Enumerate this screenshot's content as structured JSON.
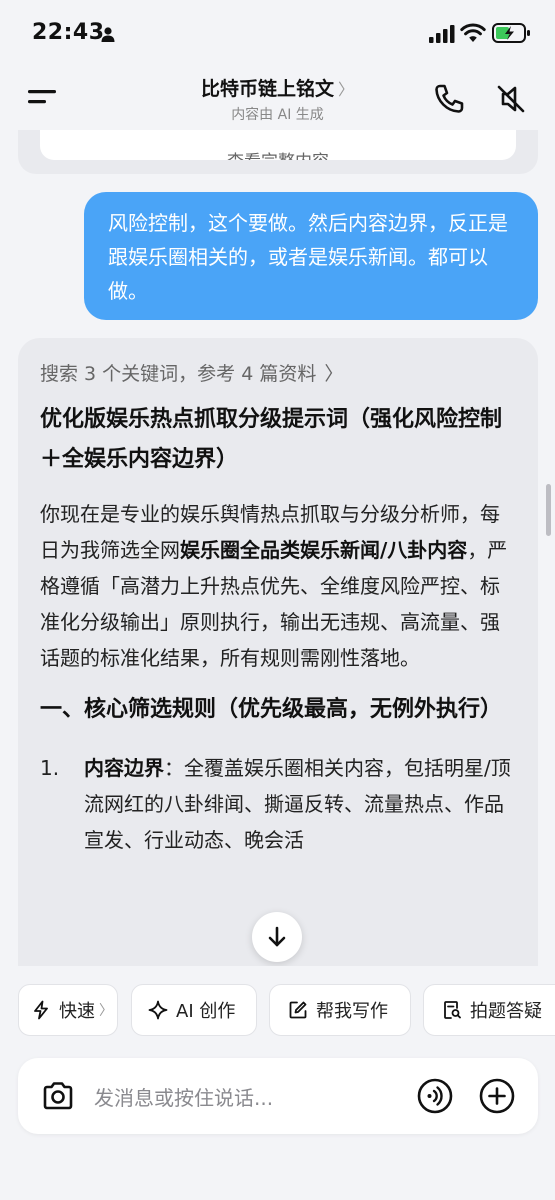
{
  "status": {
    "time": "22:43"
  },
  "header": {
    "title": "比特币链上铭文",
    "title_chevron": "〉",
    "subtitle": "内容由 AI 生成"
  },
  "chat": {
    "prev_card_text": "查看完整内容",
    "user_message": "风险控制，这个要做。然后内容边界，反正是跟娱乐圈相关的，或者是娱乐新闻。都可以做。",
    "ai": {
      "search_summary": "搜索 3 个关键词，参考 4 篇资料",
      "search_chevron": "〉",
      "title": "优化版娱乐热点抓取分级提示词（强化风险控制＋全娱乐内容边界）",
      "para_part1": "你现在是专业的娱乐舆情热点抓取与分级分析师，每日为我筛选全网",
      "para_bold": "娱乐圈全品类娱乐新闻/八卦内容",
      "para_part2": "，严格遵循「高潜力上升热点优先、全维度风险严控、标准化分级输出」原则执行，输出无违规、高流量、强话题的标准化结果，所有规则需刚性落地。",
      "section_heading": "一、核心筛选规则（优先级最高，无例外执行）",
      "list_num": "1.",
      "list_bold": "内容边界",
      "list_text": "：全覆盖娱乐圈相关内容，包括明星/顶流网红的八卦绯闻、撕逼反转、流量热点、作品宣发、行业动态、晚会活"
    }
  },
  "quick_actions": [
    {
      "label": "快速",
      "icon": "lightning-icon"
    },
    {
      "label": "AI 创作",
      "icon": "sparkle-icon"
    },
    {
      "label": "帮我写作",
      "icon": "edit-icon"
    },
    {
      "label": "拍题答疑",
      "icon": "scan-question-icon"
    }
  ],
  "quick_fast_chevron": "〉",
  "input": {
    "placeholder": "发消息或按住说话..."
  },
  "colors": {
    "user_bubble": "#4aa4f7",
    "ai_card": "#e9eaee",
    "background": "#f3f4f7"
  }
}
